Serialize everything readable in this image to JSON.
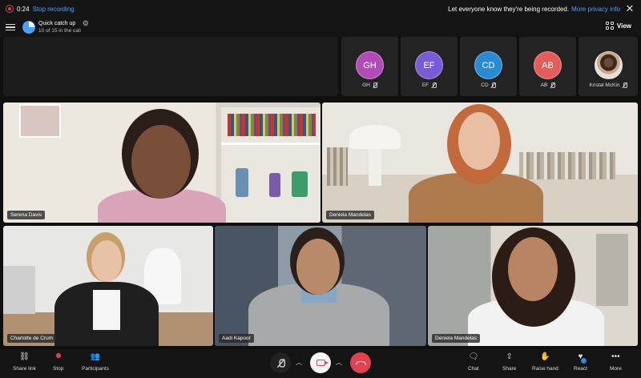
{
  "recording": {
    "time": "0:24",
    "stop_label": "Stop recording",
    "notice": "Let everyone know they're being recorded.",
    "privacy_link": "More privacy info"
  },
  "header": {
    "call_title": "Quick catch up",
    "call_subtitle": "10 of 15 in the call",
    "view_label": "View"
  },
  "participants": [
    {
      "initials": "GH",
      "name": "GH",
      "color": "#b24bb8"
    },
    {
      "initials": "EF",
      "name": "EF",
      "color": "#7a5bd6"
    },
    {
      "initials": "CD",
      "name": "CD",
      "color": "#2a8ad4"
    },
    {
      "initials": "AB",
      "name": "AB",
      "color": "#e55c5c"
    },
    {
      "initials": "",
      "name": "Kristal McKin",
      "color": "#c9a88a"
    }
  ],
  "videos": [
    {
      "name": "Serena Davis"
    },
    {
      "name": "Deniela Mandelas"
    },
    {
      "name": "Charlotte de Crum"
    },
    {
      "name": "Aadi Kapoor"
    },
    {
      "name": "Deniela Mandelas"
    }
  ],
  "controls": {
    "share_link": "Share link",
    "stop": "Stop",
    "participants": "Participants",
    "chat": "Chat",
    "share": "Share",
    "raise_hand": "Raise hand",
    "react": "React",
    "more": "More"
  }
}
